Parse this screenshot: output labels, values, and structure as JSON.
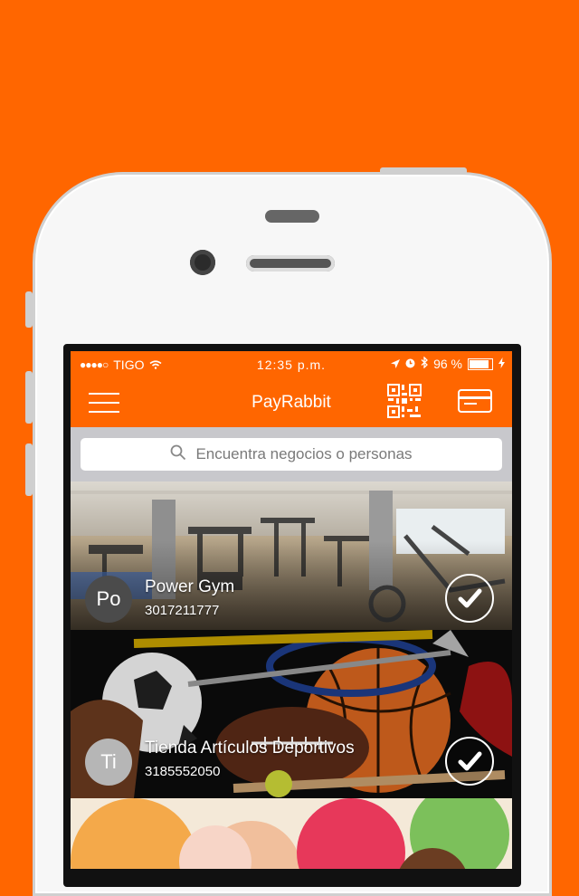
{
  "status_bar": {
    "signal_dots": "●●●●○",
    "carrier": "TIGO",
    "time": "12:35 p.m.",
    "battery_percent": "96 %",
    "battery_level": 0.96
  },
  "nav": {
    "title": "PayRabbit"
  },
  "search": {
    "placeholder": "Encuentra negocios o personas"
  },
  "businesses": [
    {
      "initials": "Po",
      "name": "Power Gym",
      "phone": "3017211777",
      "selected": true
    },
    {
      "initials": "Ti",
      "name": "Tienda Artículos Deportivos",
      "phone": "3185552050",
      "selected": true
    },
    {
      "initials": "",
      "name": "",
      "phone": "",
      "selected": false
    }
  ],
  "colors": {
    "background": "#ff6600",
    "accent": "#ff6600",
    "search_bar_bg": "#c8c8cc"
  }
}
